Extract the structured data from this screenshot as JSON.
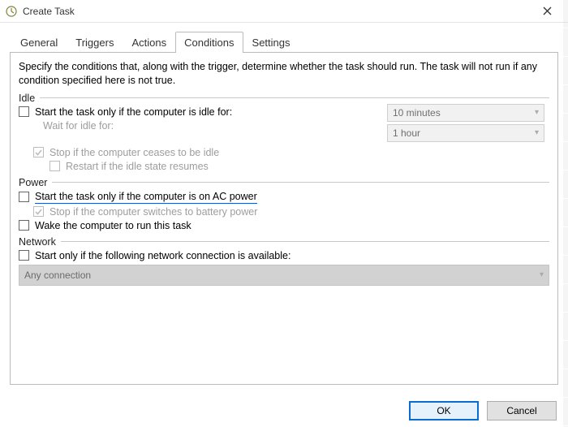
{
  "window": {
    "title": "Create Task",
    "close_icon": "×"
  },
  "tabs": {
    "items": [
      {
        "label": "General"
      },
      {
        "label": "Triggers"
      },
      {
        "label": "Actions"
      },
      {
        "label": "Conditions"
      },
      {
        "label": "Settings"
      }
    ],
    "active_index": 3
  },
  "conditions": {
    "description": "Specify the conditions that, along with the trigger, determine whether the task should run.  The task will not run  if any condition specified here is not true.",
    "idle": {
      "heading": "Idle",
      "start_if_idle": {
        "label": "Start the task only if the computer is idle for:",
        "checked": false
      },
      "idle_duration": {
        "value": "10 minutes",
        "enabled": false
      },
      "wait_label": "Wait for idle for:",
      "wait_duration": {
        "value": "1 hour",
        "enabled": false
      },
      "stop_if_ceases": {
        "label": "Stop if the computer ceases to be idle",
        "checked": true,
        "enabled": false
      },
      "restart_if_resumes": {
        "label": "Restart if the idle state resumes",
        "checked": false,
        "enabled": false
      }
    },
    "power": {
      "heading": "Power",
      "start_if_ac": {
        "label": "Start the task only if the computer is on AC power",
        "checked": false
      },
      "stop_if_battery": {
        "label": "Stop if the computer switches to battery power",
        "checked": true,
        "enabled": false
      },
      "wake_to_run": {
        "label": "Wake the computer to run this task",
        "checked": false
      }
    },
    "network": {
      "heading": "Network",
      "start_if_connection": {
        "label": "Start only if the following network connection is available:",
        "checked": false
      },
      "connection": {
        "value": "Any connection",
        "enabled": false
      }
    }
  },
  "buttons": {
    "ok": "OK",
    "cancel": "Cancel"
  }
}
